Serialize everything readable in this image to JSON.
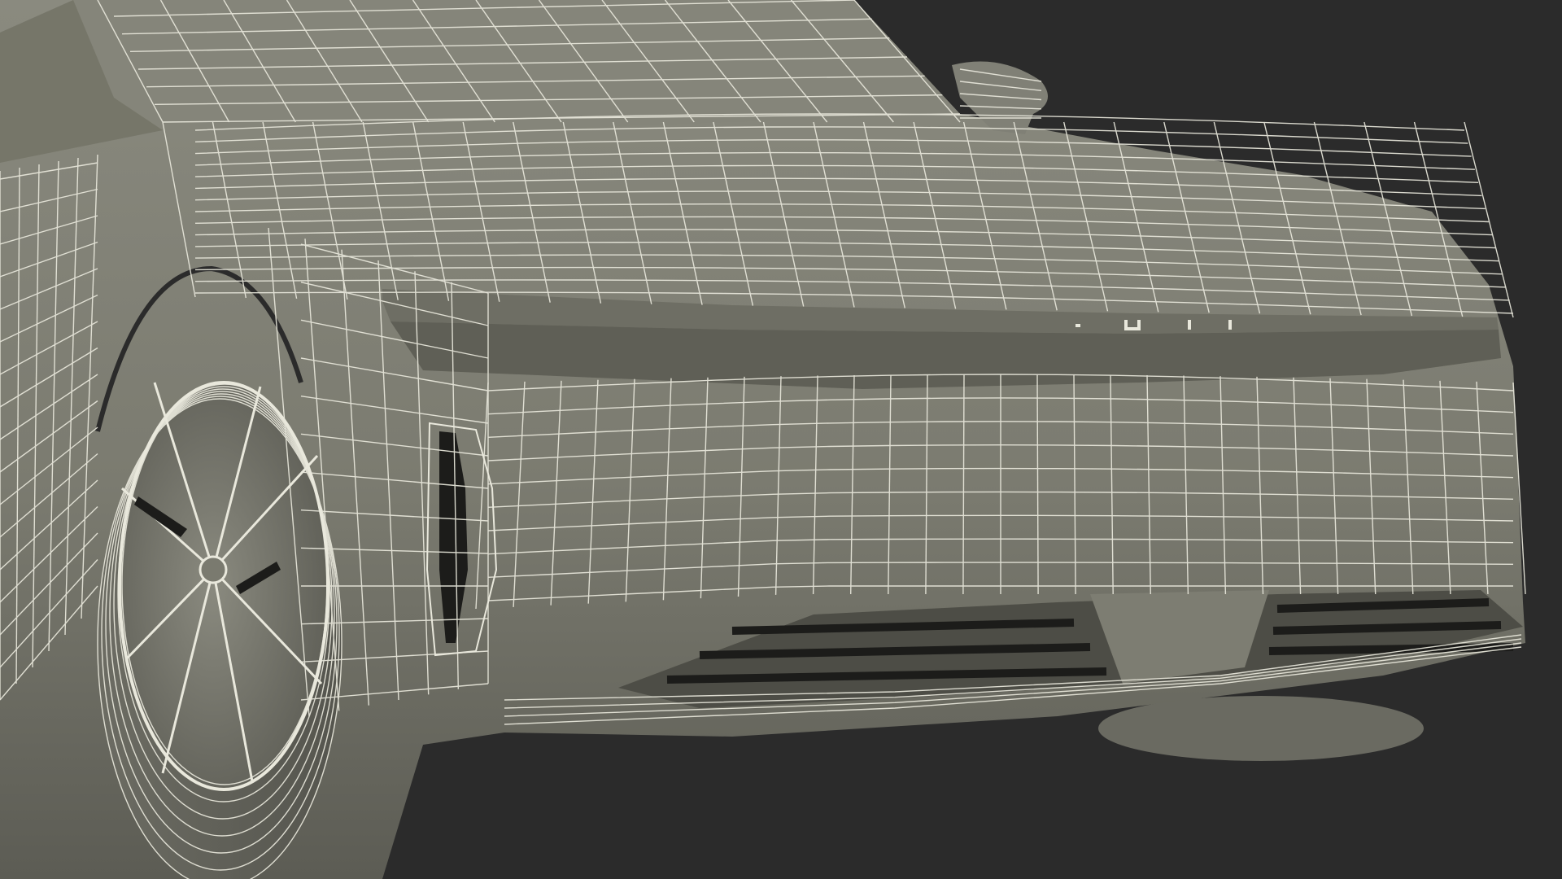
{
  "scene": {
    "subject": "car-front-wireframe-render",
    "colors": {
      "background": "#2b2b2b",
      "surface": "#7d7d72",
      "surface_light": "#8d8d82",
      "surface_dark": "#5f5f56",
      "wire": "#e9e8dc",
      "slot": "#1c1c1a"
    }
  }
}
